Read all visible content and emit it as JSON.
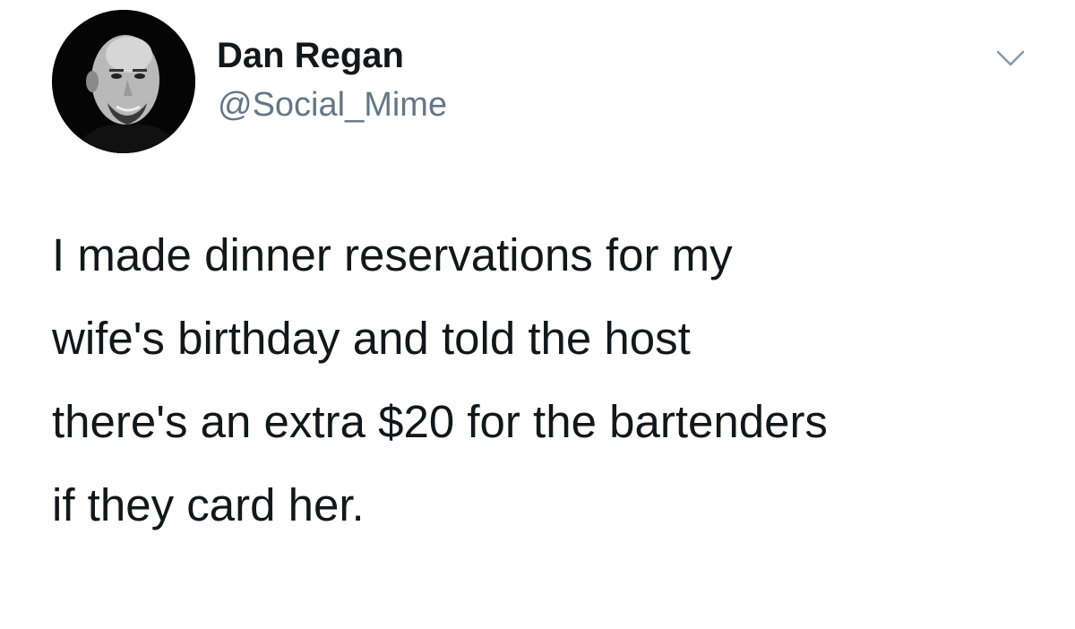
{
  "author": {
    "name": "Dan Regan",
    "handle": "@Social_Mime",
    "avatar_icon": "profile-photo"
  },
  "menu": {
    "icon": "chevron-down-icon"
  },
  "tweet": {
    "lines": [
      "I made dinner reservations for my",
      "wife's birthday and told the host",
      "there's an extra $20 for the bartenders",
      "if they card her."
    ]
  },
  "colors": {
    "text": "#14171a",
    "secondary": "#657786",
    "background": "#ffffff"
  }
}
